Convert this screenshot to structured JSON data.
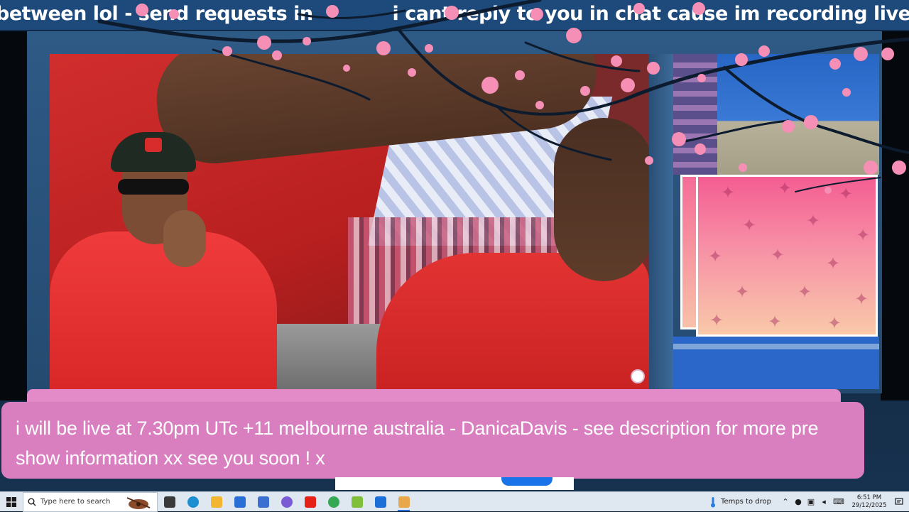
{
  "ticker": {
    "segment_1": "between lol - send requests in",
    "segment_2": "i cant reply to you in chat cause im recording live but i will inbetween"
  },
  "banner": {
    "text": "i will be live at 7.30pm UTc +11 melbourne australia - DanicaDavis - see description for more pre show information xx see you soon ! x"
  },
  "taskbar": {
    "search_placeholder": "Type here to search",
    "weather_text": "Temps to drop",
    "clock_time": "6:51 PM",
    "clock_date": "29/12/2025",
    "pinned_apps": [
      {
        "name": "task-view-icon",
        "color": "#3a3a3a"
      },
      {
        "name": "edge-icon",
        "color": "#1b8fd1"
      },
      {
        "name": "file-explorer-icon",
        "color": "#f2b632"
      },
      {
        "name": "mail-icon",
        "color": "#2a6fd6"
      },
      {
        "name": "store-icon",
        "color": "#3b6fd0"
      },
      {
        "name": "copilot-icon",
        "color": "#7b5ad6"
      },
      {
        "name": "youtube-icon",
        "color": "#e62117"
      },
      {
        "name": "chrome-icon",
        "color": "#34a853"
      },
      {
        "name": "notes-icon",
        "color": "#7fbf3a"
      },
      {
        "name": "media-player-icon",
        "color": "#1d6fd8"
      },
      {
        "name": "video-app-icon",
        "color": "#e8a74a"
      }
    ]
  },
  "colors": {
    "ticker_bg": "#1d4a7a",
    "banner_bg": "#d97fc0",
    "banner_text": "#ffffff",
    "blossom": "#f58fb5",
    "branch": "#0d1b2e",
    "taskbar_bg": "#dfe7f1"
  }
}
